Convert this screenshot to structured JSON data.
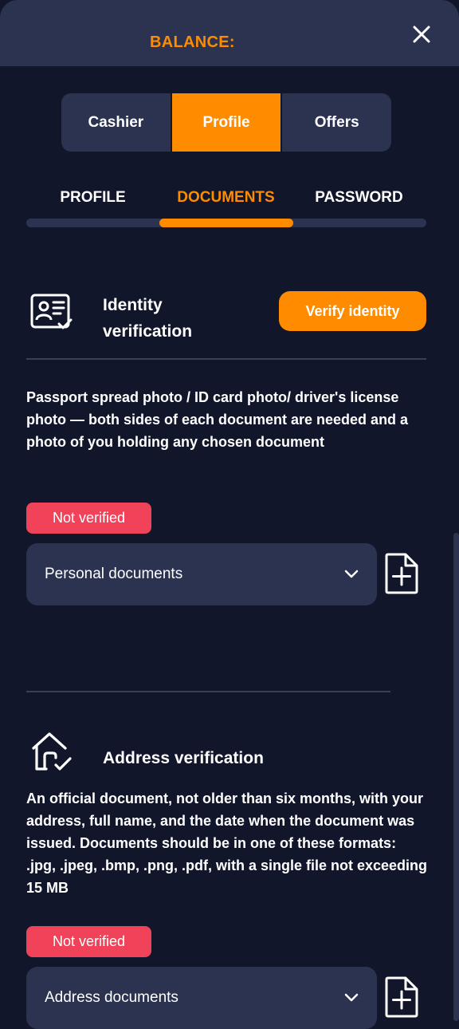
{
  "header": {
    "balance_label": "BALANCE:"
  },
  "segments": [
    {
      "label": "Cashier"
    },
    {
      "label": "Profile"
    },
    {
      "label": "Offers"
    }
  ],
  "tabs": [
    {
      "label": "PROFILE"
    },
    {
      "label": "DOCUMENTS"
    },
    {
      "label": "PASSWORD"
    }
  ],
  "identity": {
    "title_line1": "Identity",
    "title_line2": "verification",
    "verify_button": "Verify identity",
    "description": "Passport spread photo / ID card photo/ driver's license photo — both sides of each document are needed and a photo of you holding any chosen document",
    "status": "Not verified",
    "select_value": "Personal documents"
  },
  "address": {
    "title": "Address verification",
    "description": "An official document, not older than six months, with your address, full name, and the date when the document was issued. Documents should be in one of these formats: .jpg, .jpeg, .bmp, .png, .pdf, with a single file not exceeding 15 MB",
    "status": "Not verified",
    "select_value": "Address documents"
  },
  "colors": {
    "accent": "#ff8c00",
    "background": "#11162b",
    "panel": "#2b3350",
    "badge_red": "#f0435a"
  },
  "icons": [
    "close-icon",
    "id-card-check-icon",
    "chevron-down-icon",
    "file-add-icon",
    "house-check-icon"
  ]
}
